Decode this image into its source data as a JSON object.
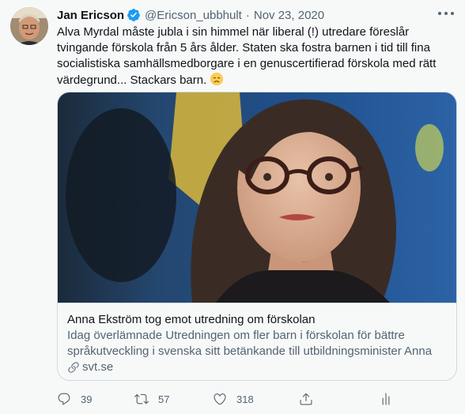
{
  "tweet": {
    "author_name": "Jan Ericson",
    "handle": "@Ericson_ubbhult",
    "separator": "·",
    "date": "Nov 23, 2020",
    "text": "Alva Myrdal måste jubla i sin himmel när liberal (!) utredare föreslår tvingande förskola från 5 års ålder. Staten ska fostra barnen i tid till fina socialistiska samhällsmedborgare i en genuscertifierad förskola med rätt värdegrund... Stackars barn.",
    "emoji_icon": "disappointed-face-emoji"
  },
  "card": {
    "title": "Anna Ekström tog emot utredning om förskolan",
    "description": "Idag överlämnade Utredningen om fler barn i förskolan för bättre språkutveckling i svenska sitt betänkande till utbildningsminister Anna …",
    "domain": "svt.se"
  },
  "actions": {
    "reply_count": "39",
    "retweet_count": "57",
    "like_count": "318"
  },
  "colors": {
    "background": "#f7f9f9",
    "text": "#0f1419",
    "secondary_text": "#536471",
    "verified_blue": "#1d9bf0",
    "border": "#cfd9de"
  }
}
